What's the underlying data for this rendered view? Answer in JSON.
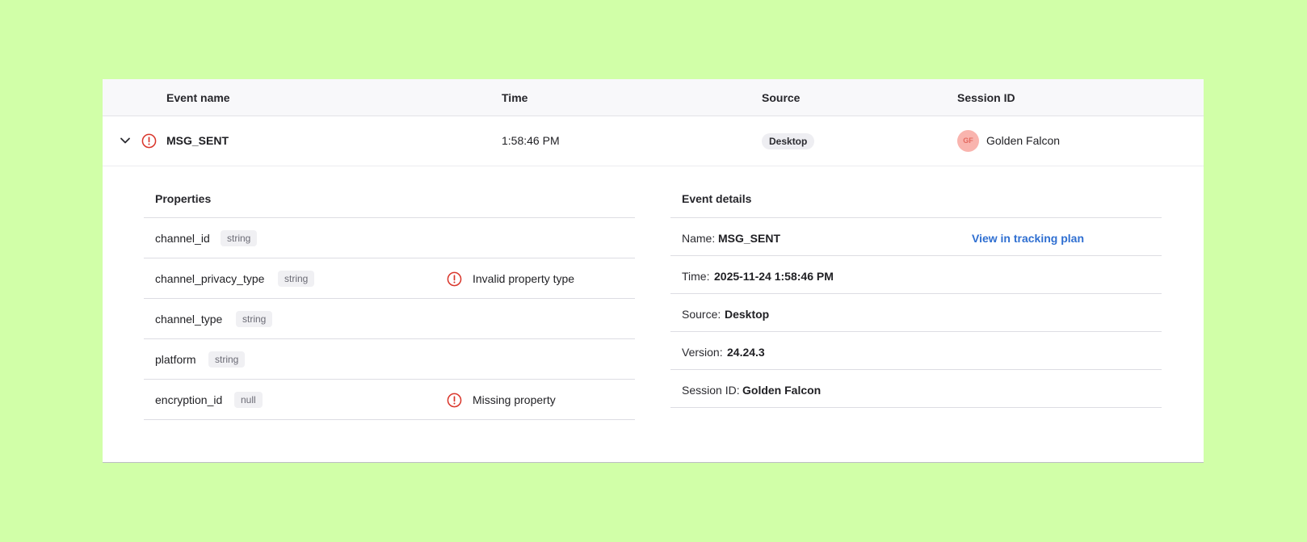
{
  "table": {
    "headers": [
      "Event name",
      "Time",
      "Source",
      "Session ID"
    ],
    "row": {
      "event_name": "MSG_SENT",
      "time": "1:58:46 PM",
      "source": "Desktop",
      "avatar_initials": "GF",
      "session": "Golden Falcon"
    }
  },
  "properties": {
    "title": "Properties",
    "items": [
      {
        "name": "channel_id",
        "type": "string",
        "error": ""
      },
      {
        "name": "channel_privacy_type",
        "type": "string",
        "error": "Invalid property type"
      },
      {
        "name": "channel_type",
        "type": "string",
        "error": ""
      },
      {
        "name": "platform",
        "type": "string",
        "error": ""
      },
      {
        "name": "encryption_id",
        "type": "null",
        "error": "Missing property"
      }
    ]
  },
  "details": {
    "title": "Event details",
    "link": "View in tracking plan",
    "items": [
      {
        "label": "Name:",
        "value": "MSG_SENT"
      },
      {
        "label": "Time:",
        "value": "2025-11-24 1:58:46 PM"
      },
      {
        "label": "Source:",
        "value": "Desktop"
      },
      {
        "label": "Version:",
        "value": "24.24.3"
      },
      {
        "label": "Session ID:",
        "value": "Golden Falcon"
      }
    ]
  },
  "colors": {
    "background": "#d1ffa8",
    "error": "#d9362b",
    "link": "#2f6fd1"
  }
}
